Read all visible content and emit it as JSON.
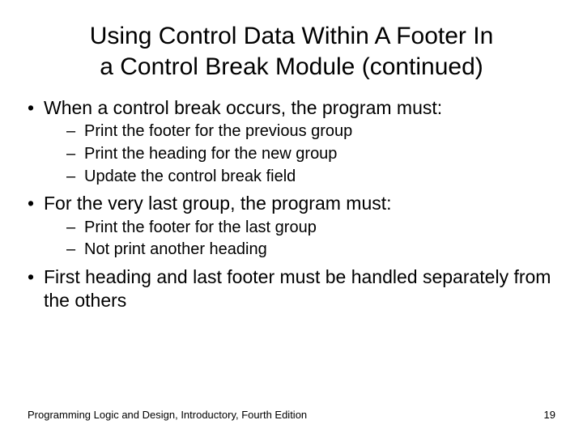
{
  "title_line1": "Using Control Data Within A Footer In",
  "title_line2": "a Control Break Module (continued)",
  "bullets": [
    {
      "text": "When a control break occurs, the program must:",
      "sub": [
        "Print the footer for the previous group",
        "Print the heading for the new group",
        "Update the control break field"
      ]
    },
    {
      "text": "For the very last group, the program must:",
      "sub": [
        "Print the footer for the last group",
        "Not print another heading"
      ]
    },
    {
      "text": "First heading and last footer must be handled separately from the others",
      "sub": []
    }
  ],
  "footer_left": "Programming Logic and Design, Introductory, Fourth Edition",
  "footer_right": "19"
}
